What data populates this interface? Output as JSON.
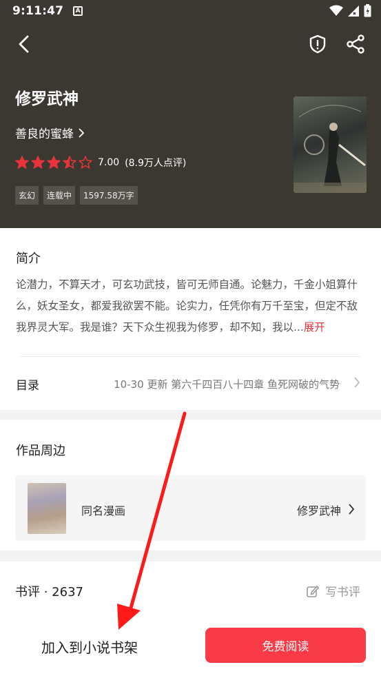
{
  "status": {
    "time": "9:11:47",
    "badge": "A"
  },
  "book": {
    "title": "修罗武神",
    "author": "善良的蜜蜂",
    "rating": "7.00",
    "rating_count": "(8.9万人点评)",
    "stars": 3.5,
    "tags": [
      "玄幻",
      "连载中",
      "1597.58万字"
    ]
  },
  "intro": {
    "title": "简介",
    "text": "论潜力，不算天才，可玄功武技，皆可无师自通。论魅力，千金小姐算什么，妖女圣女，都爱我欲罢不能。论实力，任凭你有万千至宝，但定不敌我界灵大军。我是谁？天下众生视我为修罗，却不知，我以...",
    "expand": "展开"
  },
  "toc": {
    "label": "目录",
    "info": "10-30  更新  第六千四百八十四章 鱼死网破的气势"
  },
  "works": {
    "title": "作品周边",
    "item_name": "同名漫画",
    "item_link": "修罗武神"
  },
  "review": {
    "title": "书评 · 2637",
    "write": "写书评"
  },
  "actions": {
    "add_shelf": "加入到小说书架",
    "read": "免费阅读"
  },
  "colors": {
    "header_bg": "#3b3832",
    "accent": "#f83b46",
    "star": "#e8333b"
  }
}
